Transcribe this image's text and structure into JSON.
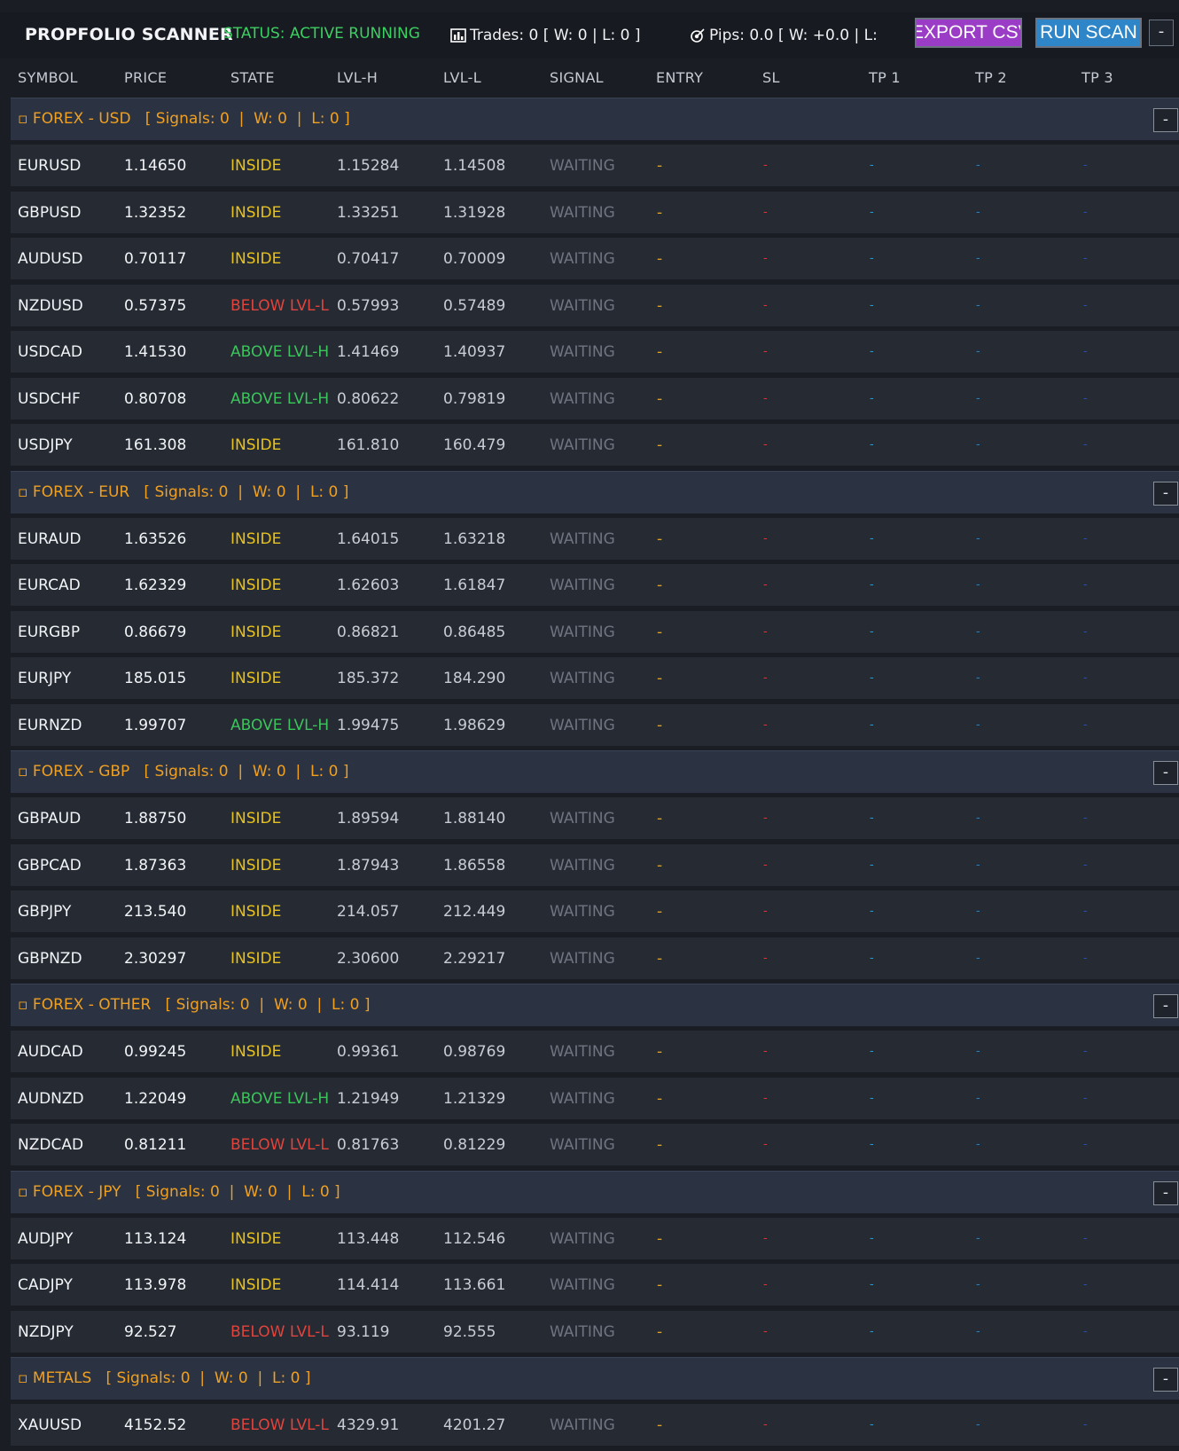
{
  "header": {
    "title": "PROPFOLIO SCANNER",
    "status": "STATUS: ACTIVE RUNNING",
    "trades": "Trades: 0  [ W: 0 | L: 0 ]",
    "pips": "Pips: 0.0  [ W: +0.0 | L:",
    "export_label": "EXPORT CSV",
    "run_label": "RUN SCAN",
    "minimize_label": "-"
  },
  "columns": [
    "SYMBOL",
    "PRICE",
    "STATE",
    "LVL-H",
    "LVL-L",
    "SIGNAL",
    "ENTRY",
    "SL",
    "TP 1",
    "TP 2",
    "TP 3"
  ],
  "colors": {
    "inside": "#e8c21e",
    "above": "#3cc45c",
    "below": "#e0443c",
    "group": "#f0a020",
    "status": "#3ccf62"
  },
  "groups": [
    {
      "label": "▫ FOREX - USD   [ Signals: 0  |  W: 0  |  L: 0 ]",
      "rows": [
        {
          "symbol": "EURUSD",
          "price": "1.14650",
          "state": "INSIDE",
          "lvlh": "1.15284",
          "lvll": "1.14508",
          "signal": "WAITING",
          "entry": "-",
          "sl": "-",
          "tp1": "-",
          "tp2": "-",
          "tp3": "-"
        },
        {
          "symbol": "GBPUSD",
          "price": "1.32352",
          "state": "INSIDE",
          "lvlh": "1.33251",
          "lvll": "1.31928",
          "signal": "WAITING",
          "entry": "-",
          "sl": "-",
          "tp1": "-",
          "tp2": "-",
          "tp3": "-"
        },
        {
          "symbol": "AUDUSD",
          "price": "0.70117",
          "state": "INSIDE",
          "lvlh": "0.70417",
          "lvll": "0.70009",
          "signal": "WAITING",
          "entry": "-",
          "sl": "-",
          "tp1": "-",
          "tp2": "-",
          "tp3": "-"
        },
        {
          "symbol": "NZDUSD",
          "price": "0.57375",
          "state": "BELOW LVL-L",
          "lvlh": "0.57993",
          "lvll": "0.57489",
          "signal": "WAITING",
          "entry": "-",
          "sl": "-",
          "tp1": "-",
          "tp2": "-",
          "tp3": "-"
        },
        {
          "symbol": "USDCAD",
          "price": "1.41530",
          "state": "ABOVE LVL-H",
          "lvlh": "1.41469",
          "lvll": "1.40937",
          "signal": "WAITING",
          "entry": "-",
          "sl": "-",
          "tp1": "-",
          "tp2": "-",
          "tp3": "-"
        },
        {
          "symbol": "USDCHF",
          "price": "0.80708",
          "state": "ABOVE LVL-H",
          "lvlh": "0.80622",
          "lvll": "0.79819",
          "signal": "WAITING",
          "entry": "-",
          "sl": "-",
          "tp1": "-",
          "tp2": "-",
          "tp3": "-"
        },
        {
          "symbol": "USDJPY",
          "price": "161.308",
          "state": "INSIDE",
          "lvlh": "161.810",
          "lvll": "160.479",
          "signal": "WAITING",
          "entry": "-",
          "sl": "-",
          "tp1": "-",
          "tp2": "-",
          "tp3": "-"
        }
      ]
    },
    {
      "label": "▫ FOREX - EUR   [ Signals: 0  |  W: 0  |  L: 0 ]",
      "rows": [
        {
          "symbol": "EURAUD",
          "price": "1.63526",
          "state": "INSIDE",
          "lvlh": "1.64015",
          "lvll": "1.63218",
          "signal": "WAITING",
          "entry": "-",
          "sl": "-",
          "tp1": "-",
          "tp2": "-",
          "tp3": "-"
        },
        {
          "symbol": "EURCAD",
          "price": "1.62329",
          "state": "INSIDE",
          "lvlh": "1.62603",
          "lvll": "1.61847",
          "signal": "WAITING",
          "entry": "-",
          "sl": "-",
          "tp1": "-",
          "tp2": "-",
          "tp3": "-"
        },
        {
          "symbol": "EURGBP",
          "price": "0.86679",
          "state": "INSIDE",
          "lvlh": "0.86821",
          "lvll": "0.86485",
          "signal": "WAITING",
          "entry": "-",
          "sl": "-",
          "tp1": "-",
          "tp2": "-",
          "tp3": "-"
        },
        {
          "symbol": "EURJPY",
          "price": "185.015",
          "state": "INSIDE",
          "lvlh": "185.372",
          "lvll": "184.290",
          "signal": "WAITING",
          "entry": "-",
          "sl": "-",
          "tp1": "-",
          "tp2": "-",
          "tp3": "-"
        },
        {
          "symbol": "EURNZD",
          "price": "1.99707",
          "state": "ABOVE LVL-H",
          "lvlh": "1.99475",
          "lvll": "1.98629",
          "signal": "WAITING",
          "entry": "-",
          "sl": "-",
          "tp1": "-",
          "tp2": "-",
          "tp3": "-"
        }
      ]
    },
    {
      "label": "▫ FOREX - GBP   [ Signals: 0  |  W: 0  |  L: 0 ]",
      "rows": [
        {
          "symbol": "GBPAUD",
          "price": "1.88750",
          "state": "INSIDE",
          "lvlh": "1.89594",
          "lvll": "1.88140",
          "signal": "WAITING",
          "entry": "-",
          "sl": "-",
          "tp1": "-",
          "tp2": "-",
          "tp3": "-"
        },
        {
          "symbol": "GBPCAD",
          "price": "1.87363",
          "state": "INSIDE",
          "lvlh": "1.87943",
          "lvll": "1.86558",
          "signal": "WAITING",
          "entry": "-",
          "sl": "-",
          "tp1": "-",
          "tp2": "-",
          "tp3": "-"
        },
        {
          "symbol": "GBPJPY",
          "price": "213.540",
          "state": "INSIDE",
          "lvlh": "214.057",
          "lvll": "212.449",
          "signal": "WAITING",
          "entry": "-",
          "sl": "-",
          "tp1": "-",
          "tp2": "-",
          "tp3": "-"
        },
        {
          "symbol": "GBPNZD",
          "price": "2.30297",
          "state": "INSIDE",
          "lvlh": "2.30600",
          "lvll": "2.29217",
          "signal": "WAITING",
          "entry": "-",
          "sl": "-",
          "tp1": "-",
          "tp2": "-",
          "tp3": "-"
        }
      ]
    },
    {
      "label": "▫ FOREX - OTHER   [ Signals: 0  |  W: 0  |  L: 0 ]",
      "rows": [
        {
          "symbol": "AUDCAD",
          "price": "0.99245",
          "state": "INSIDE",
          "lvlh": "0.99361",
          "lvll": "0.98769",
          "signal": "WAITING",
          "entry": "-",
          "sl": "-",
          "tp1": "-",
          "tp2": "-",
          "tp3": "-"
        },
        {
          "symbol": "AUDNZD",
          "price": "1.22049",
          "state": "ABOVE LVL-H",
          "lvlh": "1.21949",
          "lvll": "1.21329",
          "signal": "WAITING",
          "entry": "-",
          "sl": "-",
          "tp1": "-",
          "tp2": "-",
          "tp3": "-"
        },
        {
          "symbol": "NZDCAD",
          "price": "0.81211",
          "state": "BELOW LVL-L",
          "lvlh": "0.81763",
          "lvll": "0.81229",
          "signal": "WAITING",
          "entry": "-",
          "sl": "-",
          "tp1": "-",
          "tp2": "-",
          "tp3": "-"
        }
      ]
    },
    {
      "label": "▫ FOREX - JPY   [ Signals: 0  |  W: 0  |  L: 0 ]",
      "rows": [
        {
          "symbol": "AUDJPY",
          "price": "113.124",
          "state": "INSIDE",
          "lvlh": "113.448",
          "lvll": "112.546",
          "signal": "WAITING",
          "entry": "-",
          "sl": "-",
          "tp1": "-",
          "tp2": "-",
          "tp3": "-"
        },
        {
          "symbol": "CADJPY",
          "price": "113.978",
          "state": "INSIDE",
          "lvlh": "114.414",
          "lvll": "113.661",
          "signal": "WAITING",
          "entry": "-",
          "sl": "-",
          "tp1": "-",
          "tp2": "-",
          "tp3": "-"
        },
        {
          "symbol": "NZDJPY",
          "price": "92.527",
          "state": "BELOW LVL-L",
          "lvlh": "93.119",
          "lvll": "92.555",
          "signal": "WAITING",
          "entry": "-",
          "sl": "-",
          "tp1": "-",
          "tp2": "-",
          "tp3": "-"
        }
      ]
    },
    {
      "label": "▫ METALS   [ Signals: 0  |  W: 0  |  L: 0 ]",
      "rows": [
        {
          "symbol": "XAUUSD",
          "price": "4152.52",
          "state": "BELOW LVL-L",
          "lvlh": "4329.91",
          "lvll": "4201.27",
          "signal": "WAITING",
          "entry": "-",
          "sl": "-",
          "tp1": "-",
          "tp2": "-",
          "tp3": "-"
        }
      ]
    }
  ]
}
